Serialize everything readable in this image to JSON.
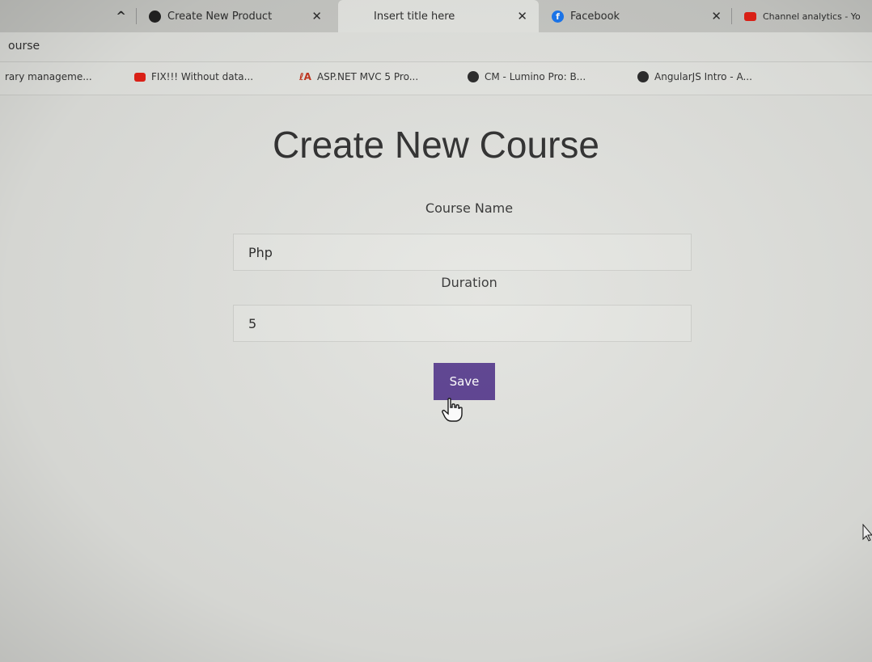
{
  "tabs": [
    {
      "label": "",
      "icon": "",
      "close": "^"
    },
    {
      "label": "Create New Product",
      "icon": "browser-globe-icon",
      "close": "✕"
    },
    {
      "label": "Insert title here",
      "icon": "",
      "close": "✕"
    },
    {
      "label": "Facebook",
      "icon": "facebook-icon",
      "close": "✕"
    },
    {
      "label": "Channel analytics - Yo",
      "icon": "youtube-icon",
      "close": ""
    }
  ],
  "address_bar": {
    "text": "ourse"
  },
  "bookmarks": [
    {
      "label": "rary manageme...",
      "icon": ""
    },
    {
      "label": "FIX!!! Without data...",
      "icon": "youtube-icon"
    },
    {
      "label": "ASP.NET MVC 5 Pro...",
      "icon": "aspnet-icon"
    },
    {
      "label": "CM - Lumino Pro: B...",
      "icon": "globe-icon"
    },
    {
      "label": "AngularJS Intro - A...",
      "icon": "globe-icon"
    }
  ],
  "form": {
    "title": "Create New Course",
    "course_name_label": "Course Name",
    "course_name_value": "Php",
    "duration_label": "Duration",
    "duration_value": "5",
    "save_label": "Save"
  },
  "colors": {
    "save_button": "#5a3f8f",
    "facebook": "#1877f2",
    "youtube": "#e62117"
  }
}
